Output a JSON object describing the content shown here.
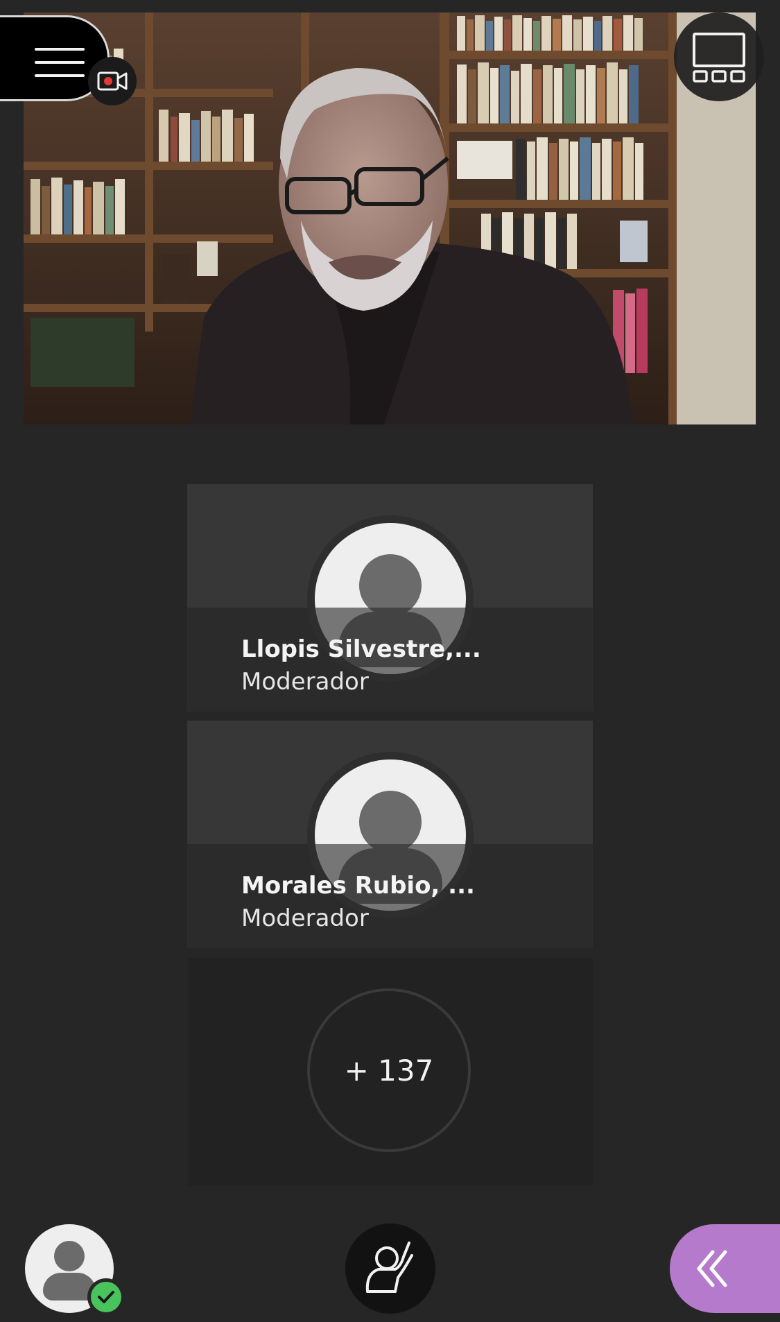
{
  "video": {
    "icon": "video-feed"
  },
  "toolbar": {
    "menu_icon": "hamburger-icon",
    "camera_icon": "camera-recording-icon",
    "layout_icon": "grid-layout-icon"
  },
  "participants": [
    {
      "name": "Llopis Silvestre,...",
      "role": "Moderador"
    },
    {
      "name": "Morales Rubio, ...",
      "role": "Moderador"
    }
  ],
  "more_participants": {
    "label": "+ 137"
  },
  "bottom_bar": {
    "my_status_icon": "avatar-icon",
    "status_badge_icon": "check-icon",
    "raise_hand_icon": "raise-hand-icon",
    "panel_toggle_icon": "double-chevron-left-icon"
  },
  "colors": {
    "background": "#262626",
    "status_ok": "#49c35c",
    "panel_accent": "#b57acb",
    "record_dot": "#e53935"
  }
}
